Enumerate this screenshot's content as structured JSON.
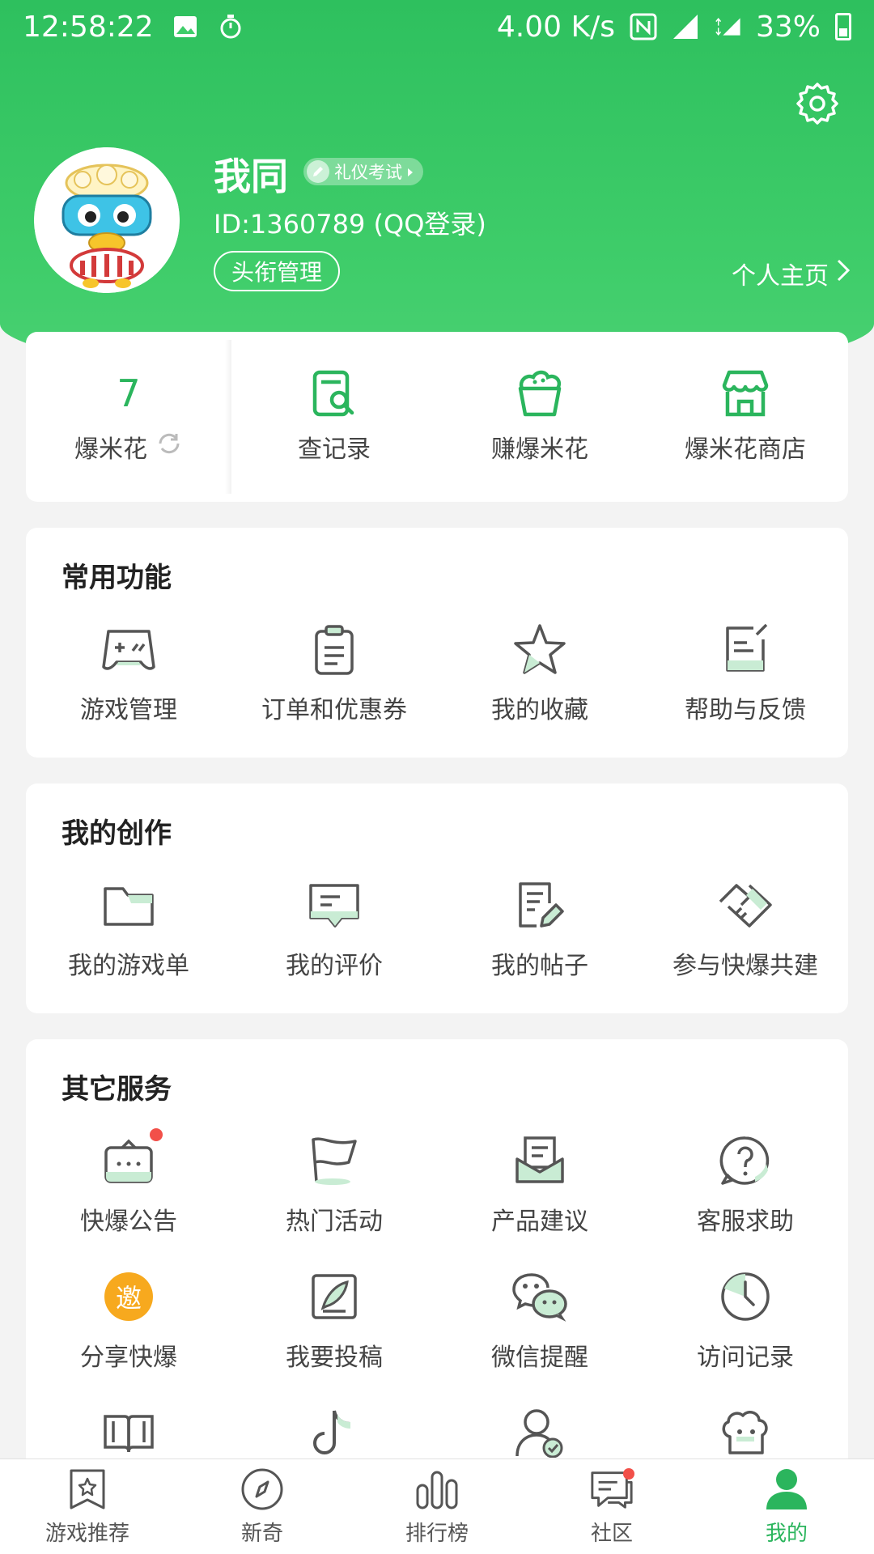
{
  "colors": {
    "brand": "#2bb55d",
    "header": "#3fcd6a",
    "alert": "#f25049",
    "invite": "#f7a91e"
  },
  "status_bar": {
    "time": "12:58:22",
    "speed": "4.00 K/s",
    "battery": "33%"
  },
  "profile": {
    "username": "我同",
    "badge": "礼仪考试",
    "user_id": "ID:1360789 (QQ登录)",
    "title_button": "头衔管理",
    "homepage_link": "个人主页"
  },
  "points": {
    "count": "7",
    "count_label": "爆米花",
    "items": [
      {
        "label": "查记录",
        "icon": "record-search-icon"
      },
      {
        "label": "赚爆米花",
        "icon": "popcorn-bucket-icon"
      },
      {
        "label": "爆米花商店",
        "icon": "store-icon"
      }
    ]
  },
  "common": {
    "title": "常用功能",
    "items": [
      {
        "label": "游戏管理",
        "icon": "gamepad-icon"
      },
      {
        "label": "订单和优惠券",
        "icon": "clipboard-icon"
      },
      {
        "label": "我的收藏",
        "icon": "star-icon"
      },
      {
        "label": "帮助与反馈",
        "icon": "feedback-icon"
      }
    ]
  },
  "creation": {
    "title": "我的创作",
    "items": [
      {
        "label": "我的游戏单",
        "icon": "folder-icon"
      },
      {
        "label": "我的评价",
        "icon": "comment-icon"
      },
      {
        "label": "我的帖子",
        "icon": "post-edit-icon"
      },
      {
        "label": "参与快爆共建",
        "icon": "handshake-icon"
      }
    ]
  },
  "services": {
    "title": "其它服务",
    "items": [
      {
        "label": "快爆公告",
        "icon": "announcement-icon"
      },
      {
        "label": "热门活动",
        "icon": "flag-icon"
      },
      {
        "label": "产品建议",
        "icon": "mail-icon"
      },
      {
        "label": "客服求助",
        "icon": "help-icon"
      },
      {
        "label": "分享快爆",
        "icon": "invite-icon",
        "glyph": "邀"
      },
      {
        "label": "我要投稿",
        "icon": "quill-icon"
      },
      {
        "label": "微信提醒",
        "icon": "wechat-icon"
      },
      {
        "label": "访问记录",
        "icon": "clock-icon"
      }
    ]
  },
  "bottom_nav": [
    {
      "label": "游戏推荐",
      "icon": "bookmark-star-icon"
    },
    {
      "label": "新奇",
      "icon": "compass-icon"
    },
    {
      "label": "排行榜",
      "icon": "bar-chart-icon"
    },
    {
      "label": "社区",
      "icon": "chat-icon"
    },
    {
      "label": "我的",
      "icon": "person-icon"
    }
  ]
}
